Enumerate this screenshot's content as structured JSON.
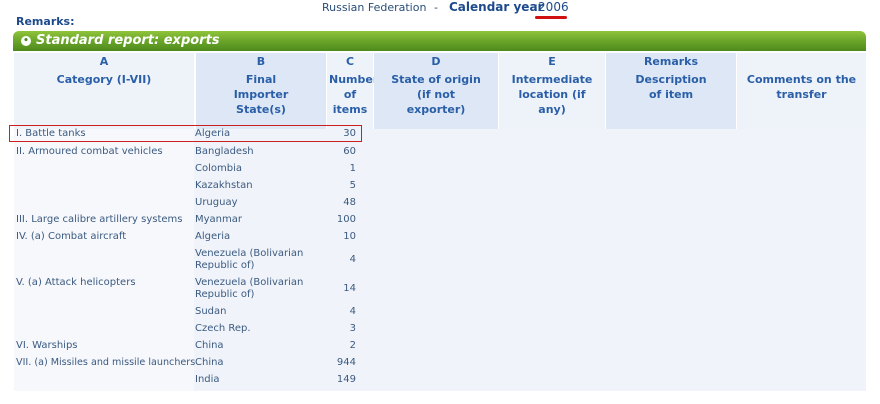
{
  "header": {
    "country": "Russian Federation",
    "separator": "-",
    "year_label": "Calendar year",
    "year_value": ":2006",
    "remarks_label": "Remarks:"
  },
  "report": {
    "title": "Standard report: exports",
    "columns": [
      {
        "letter": "A",
        "label": "Category (I-VII)"
      },
      {
        "letter": "B",
        "label": "Final Importer State(s)"
      },
      {
        "letter": "C",
        "label": "Number of items"
      },
      {
        "letter": "D",
        "label": "State of origin (if not exporter)"
      },
      {
        "letter": "E",
        "label": "Intermediate location (if any)"
      },
      {
        "letter": "Remarks",
        "label": "Description of item"
      },
      {
        "letter": "",
        "label": "Comments on the transfer"
      }
    ],
    "rows": [
      {
        "category": "I. Battle tanks",
        "state": "Algeria",
        "items": "30"
      },
      {
        "category": "II. Armoured combat vehicles",
        "state": "Bangladesh",
        "items": "60"
      },
      {
        "category": "",
        "state": "Colombia",
        "items": "1"
      },
      {
        "category": "",
        "state": "Kazakhstan",
        "items": "5"
      },
      {
        "category": "",
        "state": "Uruguay",
        "items": "48"
      },
      {
        "category": "III. Large calibre artillery systems",
        "state": "Myanmar",
        "items": "100"
      },
      {
        "category": "IV. (a) Combat aircraft",
        "state": "Algeria",
        "items": "10"
      },
      {
        "category": "",
        "state": "Venezuela (Bolivarian Republic of)",
        "items": "4"
      },
      {
        "category": "V. (a) Attack helicopters",
        "state": "Venezuela (Bolivarian Republic of)",
        "items": "14"
      },
      {
        "category": "",
        "state": "Sudan",
        "items": "4"
      },
      {
        "category": "",
        "state": "Czech Rep.",
        "items": "3"
      },
      {
        "category": "VI. Warships",
        "state": "China",
        "items": "2"
      },
      {
        "category": "VII. (a) Missiles and missile launchers",
        "state": "China",
        "items": "944"
      },
      {
        "category": "",
        "state": "India",
        "items": "149"
      }
    ]
  }
}
